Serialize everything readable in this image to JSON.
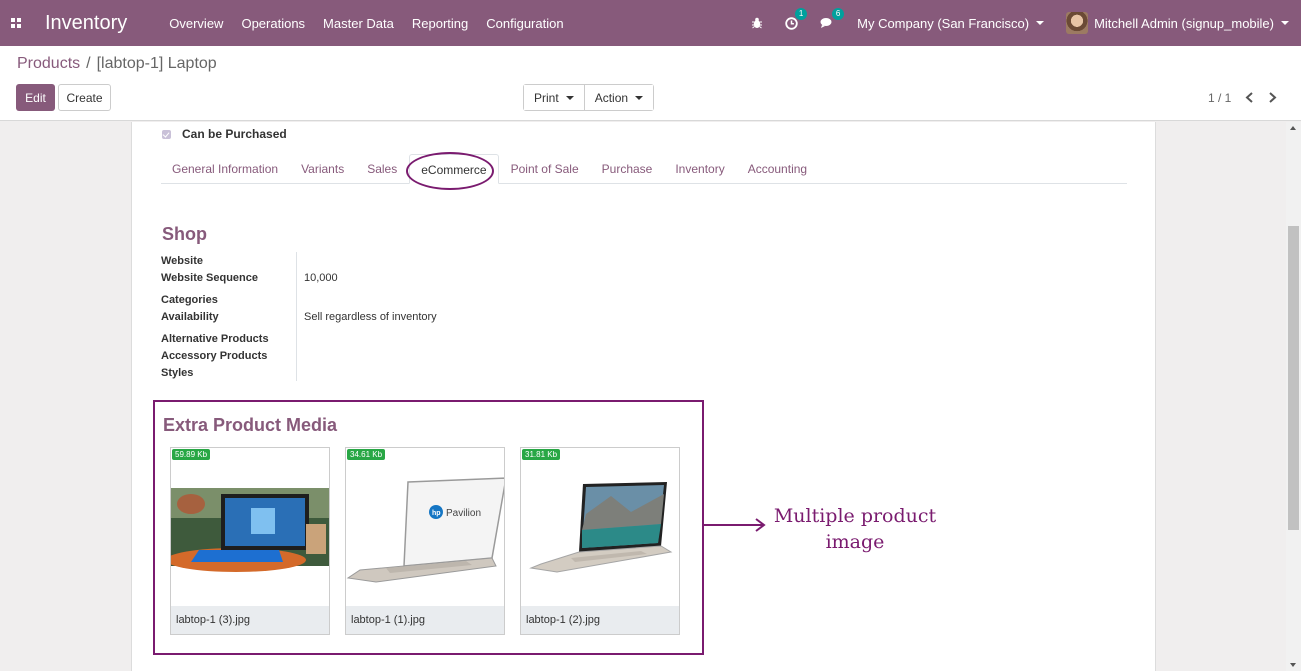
{
  "navbar": {
    "app_title": "Inventory",
    "menu": [
      "Overview",
      "Operations",
      "Master Data",
      "Reporting",
      "Configuration"
    ],
    "activity_count": "1",
    "messages_count": "6",
    "company": "My Company (San Francisco)",
    "user": "Mitchell Admin (signup_mobile)"
  },
  "breadcrumb": {
    "parent": "Products",
    "current": "[labtop-1] Laptop"
  },
  "toolbar": {
    "edit_label": "Edit",
    "create_label": "Create",
    "print_label": "Print",
    "action_label": "Action"
  },
  "pager": {
    "value": "1 / 1"
  },
  "form": {
    "can_be_purchased": "Can be Purchased",
    "tabs": [
      "General Information",
      "Variants",
      "Sales",
      "eCommerce",
      "Point of Sale",
      "Purchase",
      "Inventory",
      "Accounting"
    ],
    "active_tab": "eCommerce",
    "shop": {
      "title": "Shop",
      "fields": [
        {
          "label": "Website",
          "value": ""
        },
        {
          "label": "Website Sequence",
          "value": "10,000"
        },
        {
          "label": "Categories",
          "value": ""
        },
        {
          "label": "Availability",
          "value": "Sell regardless of inventory"
        },
        {
          "label": "Alternative Products",
          "value": ""
        },
        {
          "label": "Accessory Products",
          "value": ""
        },
        {
          "label": "Styles",
          "value": ""
        }
      ]
    },
    "extra_media": {
      "title": "Extra Product Media",
      "items": [
        {
          "size": "59.89 Kb",
          "name": "labtop-1 (3).jpg"
        },
        {
          "size": "34.61 Kb",
          "name": "labtop-1 (1).jpg"
        },
        {
          "size": "31.81 Kb",
          "name": "labtop-1 (2).jpg"
        }
      ]
    }
  },
  "annotation": {
    "line1": "Multiple  product",
    "line2": "image"
  },
  "colors": {
    "brand": "#875a7b",
    "annotation": "#7a1b6f",
    "size_badge": "#28a745"
  }
}
